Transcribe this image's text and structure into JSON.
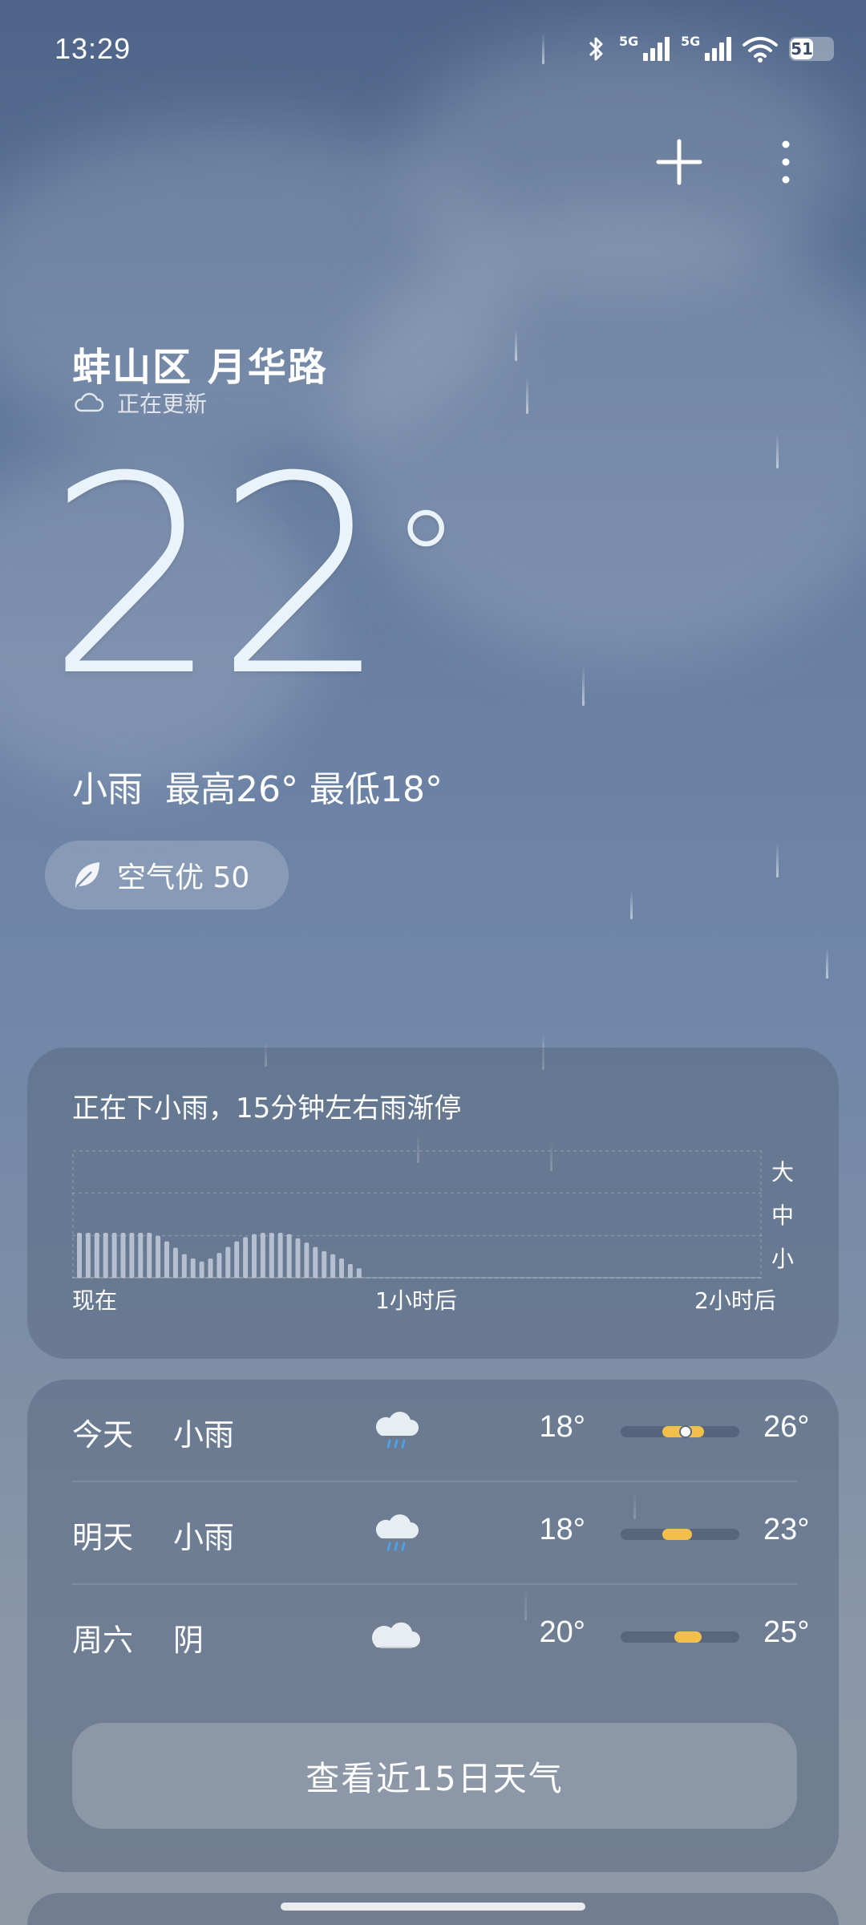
{
  "status_bar": {
    "time": "13:29",
    "network_1": "5G",
    "network_2": "5G",
    "battery": "51",
    "icons": [
      "bluetooth-icon",
      "signal-icon",
      "signal-icon",
      "wifi-icon",
      "battery-icon"
    ]
  },
  "top_actions": {
    "add": "plus-icon",
    "menu": "more-vertical-icon"
  },
  "location": {
    "name": "蚌山区 月华路",
    "update_status": "正在更新"
  },
  "current": {
    "temperature": "22",
    "degree_symbol": "°",
    "condition": "小雨",
    "high": "最高26°",
    "low": "最低18°"
  },
  "air_quality": {
    "label": "空气优 50"
  },
  "precipitation": {
    "summary": "正在下小雨，15分钟左右雨渐停",
    "y_levels": [
      "大",
      "中",
      "小"
    ],
    "x_labels": [
      "现在",
      "1小时后",
      "2小时后"
    ],
    "colors": {
      "bar": "#c8d1de"
    },
    "chart_data": {
      "type": "bar",
      "title": "",
      "xlabel": "",
      "ylabel": "",
      "y_levels": [
        "小",
        "中",
        "大"
      ],
      "x_ticks": [
        "现在",
        "1小时后",
        "2小时后"
      ],
      "ylim": [
        0,
        3
      ],
      "values": [
        1.05,
        1.05,
        1.05,
        1.05,
        1.05,
        1.05,
        1.05,
        1.05,
        1.05,
        0.98,
        0.85,
        0.7,
        0.55,
        0.45,
        0.38,
        0.45,
        0.58,
        0.72,
        0.85,
        0.95,
        1.02,
        1.05,
        1.05,
        1.05,
        1.02,
        0.92,
        0.82,
        0.72,
        0.62,
        0.55,
        0.45,
        0.32,
        0.22
      ]
    }
  },
  "forecast": {
    "colors": {
      "range": "#f2c04a",
      "track": "#4a5a76"
    },
    "days": [
      {
        "day": "今天",
        "condition": "小雨",
        "icon": "rain-cloud-icon",
        "low": "18°",
        "high": "26°",
        "range": [
          0.35,
          0.7
        ],
        "current_marker": 0.55
      },
      {
        "day": "明天",
        "condition": "小雨",
        "icon": "rain-cloud-icon",
        "low": "18°",
        "high": "23°",
        "range": [
          0.35,
          0.6
        ]
      },
      {
        "day": "周六",
        "condition": "阴",
        "icon": "overcast-cloud-icon",
        "low": "20°",
        "high": "25°",
        "range": [
          0.45,
          0.68
        ]
      }
    ],
    "view_more": "查看近15日天气"
  }
}
